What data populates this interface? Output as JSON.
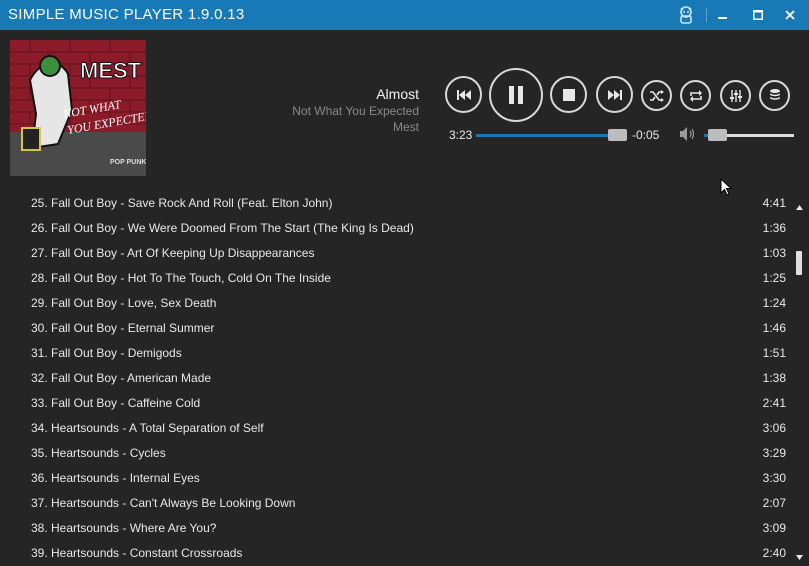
{
  "window": {
    "title": "SIMPLE MUSIC PLAYER 1.9.0.13"
  },
  "album_art": {
    "text_top": "MEST",
    "text_script": "NOT WHAT YOU EXPECTED",
    "text_badge": "POP PUNK"
  },
  "now_playing": {
    "title": "Almost",
    "album": "Not What You Expected",
    "artist": "Mest"
  },
  "controls": {
    "icons": [
      "previous-icon",
      "pause-icon",
      "stop-icon",
      "next-icon",
      "shuffle-icon",
      "repeat-icon",
      "equalizer-icon",
      "library-icon"
    ]
  },
  "progress": {
    "elapsed": "3:23",
    "remaining": "-0:05",
    "fraction": 0.97
  },
  "volume": {
    "fraction": 0.2
  },
  "playlist": {
    "items": [
      {
        "title": "25. Fall Out Boy - Save Rock And Roll (Feat. Elton John)",
        "duration": "4:41"
      },
      {
        "title": "26. Fall Out Boy - We Were Doomed From The Start (The King Is Dead)",
        "duration": "1:36"
      },
      {
        "title": "27. Fall Out Boy - Art Of Keeping Up Disappearances",
        "duration": "1:03"
      },
      {
        "title": "28. Fall Out Boy - Hot To The Touch, Cold On The Inside",
        "duration": "1:25"
      },
      {
        "title": "29. Fall Out Boy - Love, Sex Death",
        "duration": "1:24"
      },
      {
        "title": "30. Fall Out Boy - Eternal Summer",
        "duration": "1:46"
      },
      {
        "title": "31. Fall Out Boy - Demigods",
        "duration": "1:51"
      },
      {
        "title": "32. Fall Out Boy - American Made",
        "duration": "1:38"
      },
      {
        "title": "33. Fall Out Boy - Caffeine Cold",
        "duration": "2:41"
      },
      {
        "title": "34. Heartsounds - A Total Separation of Self",
        "duration": "3:06"
      },
      {
        "title": "35. Heartsounds - Cycles",
        "duration": "3:29"
      },
      {
        "title": "36. Heartsounds - Internal Eyes",
        "duration": "3:30"
      },
      {
        "title": "37. Heartsounds - Can't Always Be Looking Down",
        "duration": "2:07"
      },
      {
        "title": "38. Heartsounds - Where Are You?",
        "duration": "3:09"
      },
      {
        "title": "39. Heartsounds - Constant Crossroads",
        "duration": "2:40"
      }
    ]
  },
  "colors": {
    "accent": "#1779b5",
    "background": "#252525",
    "text": "#e8e8e8",
    "muted": "#8a8a8a"
  }
}
